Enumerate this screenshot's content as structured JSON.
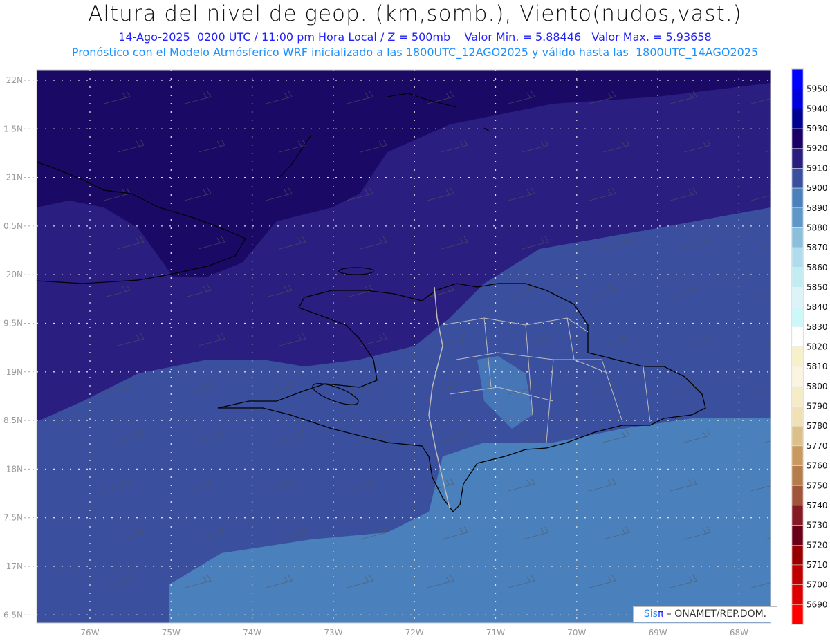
{
  "header": {
    "title": "Altura del nivel de geop. (km,somb.), Viento(nudos,vast.)",
    "subtitle": "14-Ago-2025  0200 UTC / 11:00 pm Hora Local / Z = 500mb    Valor Min. = 5.88446   Valor Max. = 5.93658",
    "model_info": "Pronóstico con el Modelo Atmósferico WRF inicializado a las 1800UTC_12AGO2025 y válido hasta las  1800UTC_14AGO2025"
  },
  "axes": {
    "lat_labels": [
      "22N",
      "1.5N",
      "21N",
      "0.5N",
      "20N",
      "9.5N",
      "19N",
      "8.5N",
      "18N",
      "7.5N",
      "17N",
      "6.5N"
    ],
    "lon_labels": [
      "76W",
      "75W",
      "74W",
      "73W",
      "72W",
      "71W",
      "70W",
      "69W",
      "68W"
    ]
  },
  "colorbar": {
    "labels": [
      "5950",
      "5940",
      "5930",
      "5920",
      "5910",
      "5900",
      "5890",
      "5880",
      "5870",
      "5860",
      "5850",
      "5840",
      "5830",
      "5820",
      "5810",
      "5800",
      "5790",
      "5780",
      "5770",
      "5760",
      "5750",
      "5740",
      "5730",
      "5720",
      "5710",
      "5700",
      "5690"
    ],
    "colors": [
      "#0000ff",
      "#0000dd",
      "#000090",
      "#1a0066",
      "#2a1e80",
      "#3a509e",
      "#4a80bb",
      "#5f98c8",
      "#8cbfdc",
      "#b0dded",
      "#c2ebf2",
      "#dcf4f8",
      "#ccf8fa",
      "#ffffff",
      "#f8f0c8",
      "#faf4e0",
      "#f5ebc5",
      "#efe0b5",
      "#dcc08a",
      "#c89a60",
      "#b57d4b",
      "#a0553a",
      "#851a25",
      "#6a0018",
      "#980000",
      "#bf0000",
      "#de0000",
      "#ff0000"
    ]
  },
  "credit": {
    "sis": "Sis",
    "pi": "π",
    "org": " – ONAMET/REP.DOM."
  }
}
